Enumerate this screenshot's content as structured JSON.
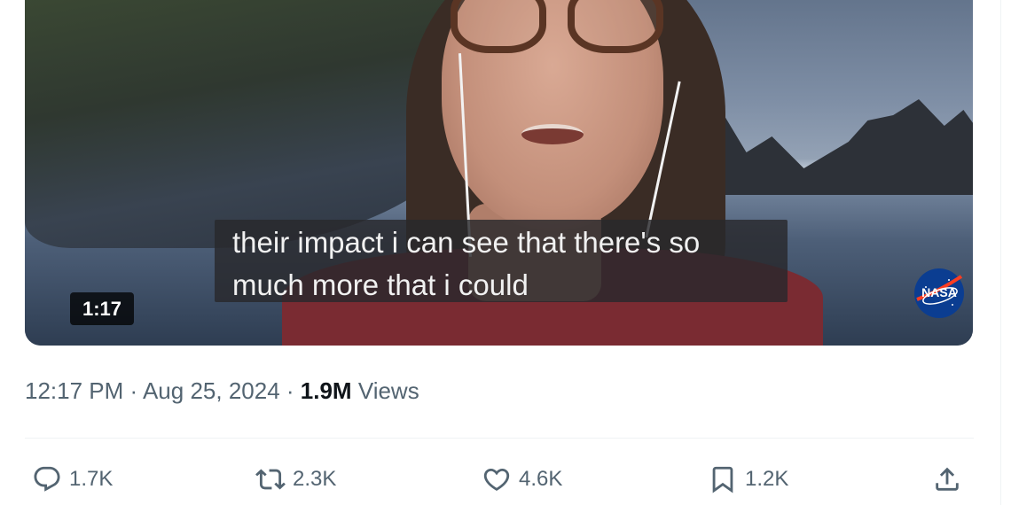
{
  "video": {
    "caption_lines": [
      "their impact i can see that there's so",
      "much more that i could"
    ],
    "duration": "1:17",
    "watermark_logo": "NASA",
    "watermark_logo_icon": "nasa-meatball-logo"
  },
  "post_meta": {
    "time": "12:17 PM",
    "separator": " · ",
    "date": "Aug 25, 2024",
    "views_count": "1.9M",
    "views_label": " Views"
  },
  "actions": {
    "reply": {
      "icon": "reply-bubble-icon",
      "count": "1.7K"
    },
    "repost": {
      "icon": "repost-arrows-icon",
      "count": "2.3K"
    },
    "like": {
      "icon": "heart-icon",
      "count": "4.6K"
    },
    "bookmark": {
      "icon": "bookmark-icon",
      "count": "1.2K"
    },
    "share": {
      "icon": "share-upload-icon"
    }
  },
  "colors": {
    "secondary_text": "#536471",
    "primary_text": "#0f1419",
    "divider": "#eff3f4",
    "caption_background": "rgba(40,40,44,0.82)"
  }
}
